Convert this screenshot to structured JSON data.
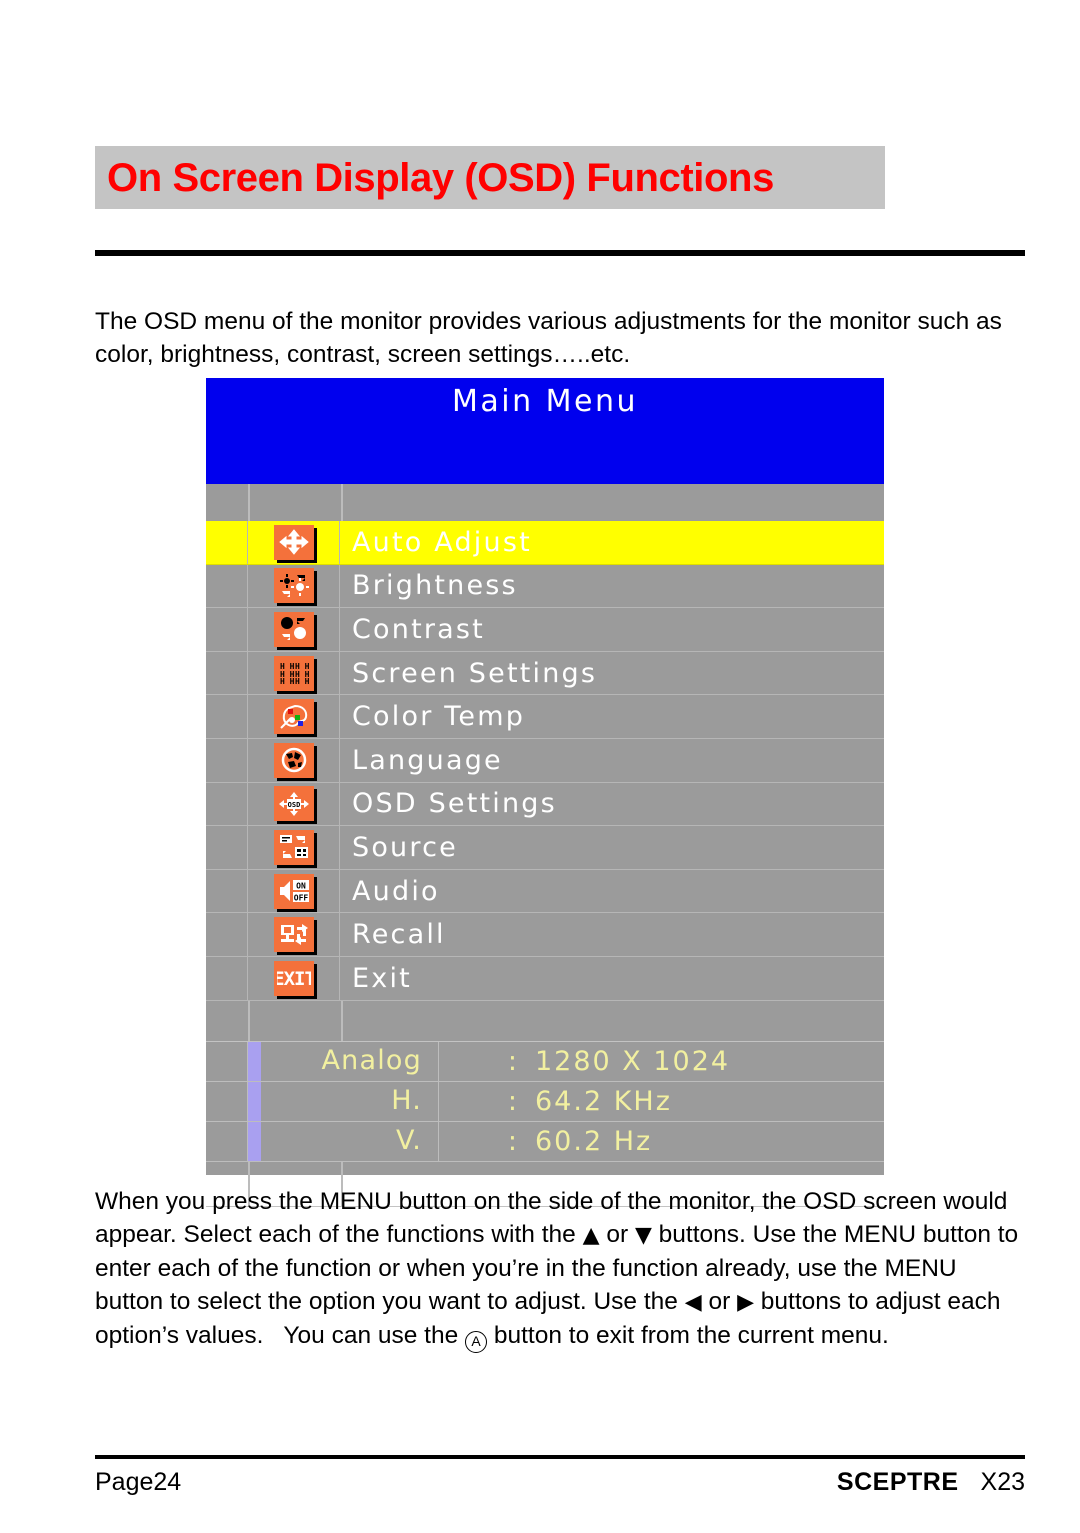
{
  "page": {
    "title": "On Screen Display (OSD) Functions",
    "title_color": "#ff0000",
    "banner_color": "#c4c4c4"
  },
  "intro_paragraph": "The OSD menu of the monitor provides various adjustments for the monitor such as color, brightness, contrast, screen settings…..etc.",
  "osd": {
    "header_title": "Main Menu",
    "header_color": "#0000ee",
    "background_color": "#9b9b9b",
    "highlight_color": "#ffff00",
    "icon_color": "#f4713b",
    "status_text_color": "#f2f0a0",
    "status_bar_color": "#a9a0f0",
    "menu_items": [
      {
        "label": "Auto Adjust",
        "icon": "four-way-arrows-icon",
        "selected": true
      },
      {
        "label": "Brightness",
        "icon": "brightness-sun-icon",
        "selected": false
      },
      {
        "label": "Contrast",
        "icon": "contrast-circles-icon",
        "selected": false
      },
      {
        "label": "Screen Settings",
        "icon": "screen-grid-icon",
        "selected": false
      },
      {
        "label": "Color Temp",
        "icon": "color-palette-icon",
        "selected": false
      },
      {
        "label": "Language",
        "icon": "globe-icon",
        "selected": false
      },
      {
        "label": "OSD Settings",
        "icon": "osd-arrows-icon",
        "selected": false
      },
      {
        "label": "Source",
        "icon": "source-swap-icon",
        "selected": false
      },
      {
        "label": "Audio",
        "icon": "audio-onoff-icon",
        "selected": false
      },
      {
        "label": "Recall",
        "icon": "recall-monitor-icon",
        "selected": false
      },
      {
        "label": "Exit",
        "icon": "exit-icon",
        "selected": false
      }
    ],
    "status_rows": [
      {
        "label": "Analog",
        "separator": ":",
        "value": "1280 X 1024"
      },
      {
        "label": "H.",
        "separator": ":",
        "value": "64.2 KHz"
      },
      {
        "label": "V.",
        "separator": ":",
        "value": "60.2 Hz"
      }
    ]
  },
  "body_paragraph": {
    "part1": "When you press the MENU button on the side of the monitor, the OSD screen would appear. Select each of the functions with the ",
    "up_glyph": "▲",
    "part2": " or ",
    "down_glyph": "▼",
    "part3": " buttons. Use the MENU button to enter each of the function or when you’re in the function already, use the MENU button to select the option you want to adjust. Use the ",
    "left_glyph": "◀",
    "part4": " or ",
    "right_glyph": "▶",
    "part5": " buttons to adjust each option’s values.   You can use the ",
    "a_button": "A",
    "part6": " button to exit from the current menu."
  },
  "footer": {
    "page_label": "Page24",
    "brand": "SCEPTRE",
    "model": "X23"
  }
}
